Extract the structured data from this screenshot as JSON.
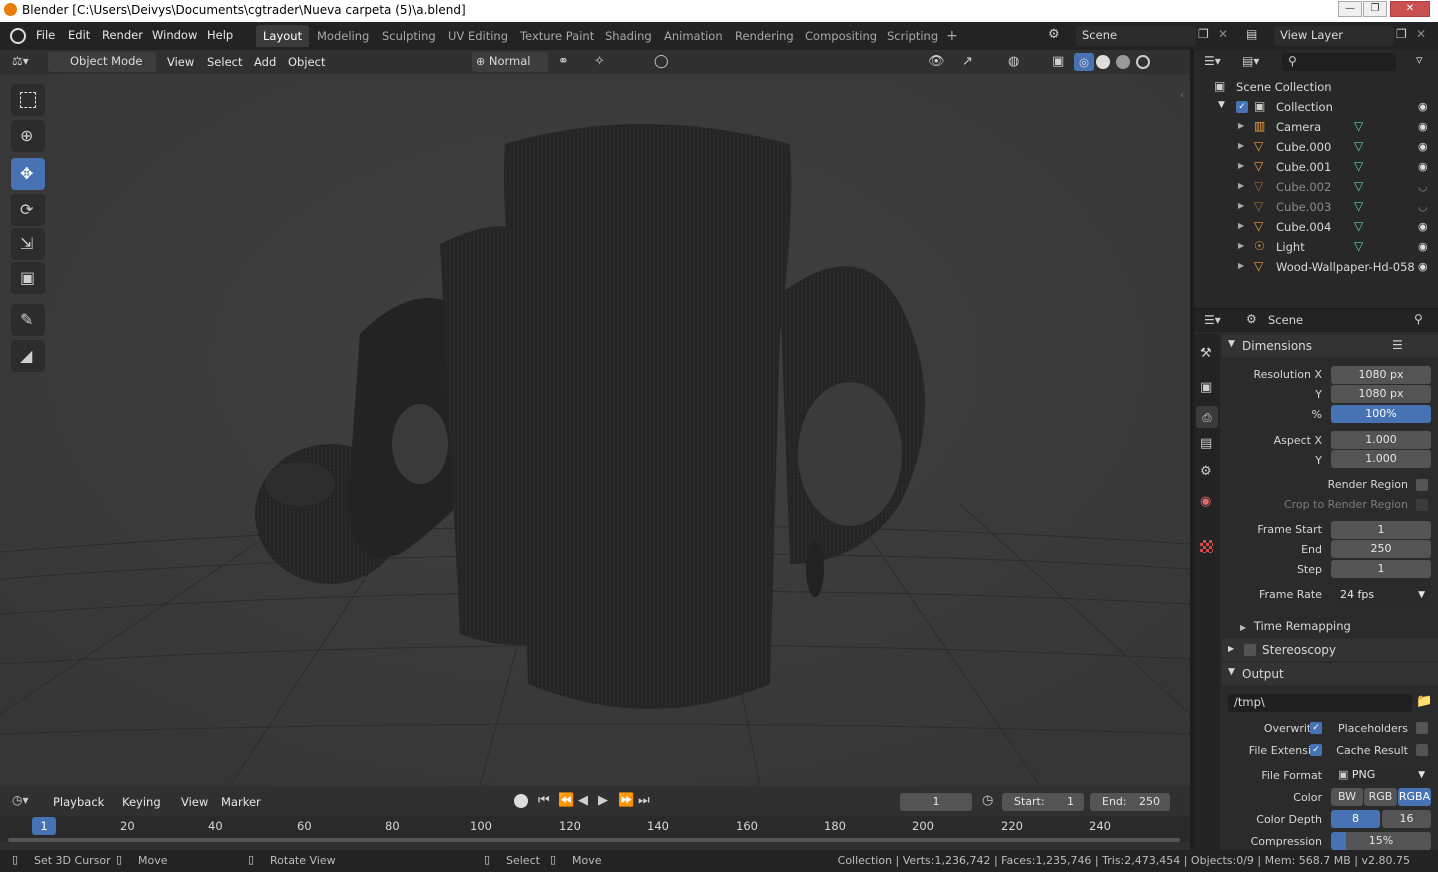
{
  "window": {
    "title": "Blender [C:\\Users\\Deivys\\Documents\\cgtrader\\Nueva carpeta (5)\\a.blend]",
    "minimize": "—",
    "maximize": "❐",
    "close": "✕"
  },
  "menus": [
    "File",
    "Edit",
    "Render",
    "Window",
    "Help"
  ],
  "workspaces": [
    "Layout",
    "Modeling",
    "Sculpting",
    "UV Editing",
    "Texture Paint",
    "Shading",
    "Animation",
    "Rendering",
    "Compositing",
    "Scripting"
  ],
  "scene_name": "Scene",
  "view_layer": "View Layer",
  "viewport_header": {
    "mode": "Object Mode",
    "menus": [
      "View",
      "Select",
      "Add",
      "Object"
    ],
    "orientation": "Normal"
  },
  "outliner": {
    "root": "Scene Collection",
    "collection": "Collection",
    "items": [
      {
        "name": "Camera",
        "dim": false,
        "visible": true
      },
      {
        "name": "Cube.000",
        "dim": false,
        "visible": true
      },
      {
        "name": "Cube.001",
        "dim": false,
        "visible": true
      },
      {
        "name": "Cube.002",
        "dim": true,
        "visible": false
      },
      {
        "name": "Cube.003",
        "dim": true,
        "visible": false
      },
      {
        "name": "Cube.004",
        "dim": false,
        "visible": true
      },
      {
        "name": "Light",
        "dim": false,
        "visible": true
      },
      {
        "name": "Wood-Wallpaper-Hd-058",
        "dim": false,
        "visible": true
      }
    ]
  },
  "properties": {
    "context": "Scene",
    "dimensions": {
      "title": "Dimensions",
      "res_x_label": "Resolution X",
      "res_x": "1080 px",
      "y_label": "Y",
      "res_y": "1080 px",
      "pct_label": "%",
      "pct": "100%",
      "aspect_x_label": "Aspect X",
      "aspect_x": "1.000",
      "aspect_y": "1.000",
      "render_region": "Render Region",
      "crop": "Crop to Render Region",
      "frame_start_label": "Frame Start",
      "frame_start": "1",
      "end_label": "End",
      "end": "250",
      "step_label": "Step",
      "step": "1",
      "frame_rate_label": "Frame Rate",
      "frame_rate": "24 fps",
      "time_remap": "Time Remapping"
    },
    "stereoscopy": "Stereoscopy",
    "output": {
      "title": "Output",
      "path": "/tmp\\",
      "overwrite": "Overwrite",
      "placeholders": "Placeholders",
      "file_ext": "File Extensi..",
      "cache": "Cache Result",
      "format_label": "File Format",
      "format": "PNG",
      "color_label": "Color",
      "color_opts": [
        "BW",
        "RGB",
        "RGBA"
      ],
      "depth_label": "Color Depth",
      "depth_opts": [
        "8",
        "16"
      ],
      "compression_label": "Compression",
      "compression": "15%"
    }
  },
  "timeline": {
    "menus": [
      "Playback",
      "Keying",
      "View",
      "Marker"
    ],
    "current": "1",
    "start_label": "Start:",
    "start": "1",
    "end_label": "End:",
    "end": "250",
    "ticks": [
      "1",
      "20",
      "40",
      "60",
      "80",
      "100",
      "120",
      "140",
      "160",
      "180",
      "200",
      "220",
      "240"
    ]
  },
  "status": {
    "hints": [
      "Set 3D Cursor",
      "Move",
      "Rotate View",
      "Select",
      "Move"
    ],
    "info": "Collection | Verts:1,236,742 | Faces:1,235,746 | Tris:2,473,454 | Objects:0/9 | Mem: 568.7 MB | v2.80.75"
  }
}
